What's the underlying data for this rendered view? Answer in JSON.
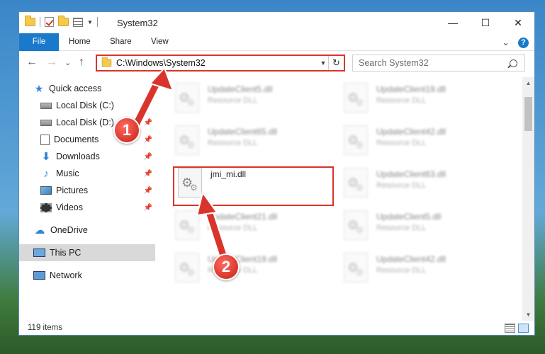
{
  "window": {
    "title": "System32",
    "controls": {
      "minimize": "—",
      "maximize": "☐",
      "close": "✕"
    }
  },
  "ribbon": {
    "tabs": [
      "File",
      "Home",
      "Share",
      "View"
    ],
    "expand": "⌄",
    "help": "?"
  },
  "navigation": {
    "back": "←",
    "forward": "→",
    "recent": "⌄",
    "up": "↑",
    "address": "C:\\Windows\\System32",
    "refresh": "↻",
    "search_placeholder": "Search System32"
  },
  "sidebar": {
    "items": [
      {
        "label": "Quick access",
        "icon": "star-icon"
      },
      {
        "label": "Local Disk (C:)",
        "icon": "disk-icon",
        "pinned": true
      },
      {
        "label": "Local Disk (D:)",
        "icon": "disk-icon",
        "pinned": true
      },
      {
        "label": "Documents",
        "icon": "document-icon",
        "pinned": true
      },
      {
        "label": "Downloads",
        "icon": "download-icon",
        "pinned": true
      },
      {
        "label": "Music",
        "icon": "music-icon",
        "pinned": true
      },
      {
        "label": "Pictures",
        "icon": "picture-icon",
        "pinned": true
      },
      {
        "label": "Videos",
        "icon": "video-icon",
        "pinned": true
      },
      {
        "label": "OneDrive",
        "icon": "cloud-icon"
      },
      {
        "label": "This PC",
        "icon": "computer-icon",
        "selected": true
      },
      {
        "label": "Network",
        "icon": "network-icon"
      }
    ]
  },
  "files": [
    {
      "name": "UpdateClient5.dll",
      "type": "Resource DLL"
    },
    {
      "name": "UpdateClient19.dll",
      "type": "Resource DLL"
    },
    {
      "name": "UpdateClient65.dll",
      "type": "Resource DLL"
    },
    {
      "name": "UpdateClient42.dll",
      "type": "Resource DLL"
    },
    {
      "name": "jmi_mi.dll",
      "type": ""
    },
    {
      "name": "UpdateClient63.dll",
      "type": "Resource DLL"
    },
    {
      "name": "UpdateClient21.dll",
      "type": "Resource DLL"
    },
    {
      "name": "UpdateClient5.dll",
      "type": "Resource DLL"
    },
    {
      "name": "UpdateClient19.dll",
      "type": "Resource DLL"
    },
    {
      "name": "UpdateClient42.dll",
      "type": "Resource DLL"
    }
  ],
  "status": {
    "item_count": "119 items"
  },
  "annotations": {
    "step1": "1",
    "step2": "2",
    "color": "#d9342b"
  },
  "colors": {
    "accent": "#1979ca",
    "highlight": "#d9342b",
    "selected_bg": "#d9d9d9"
  }
}
